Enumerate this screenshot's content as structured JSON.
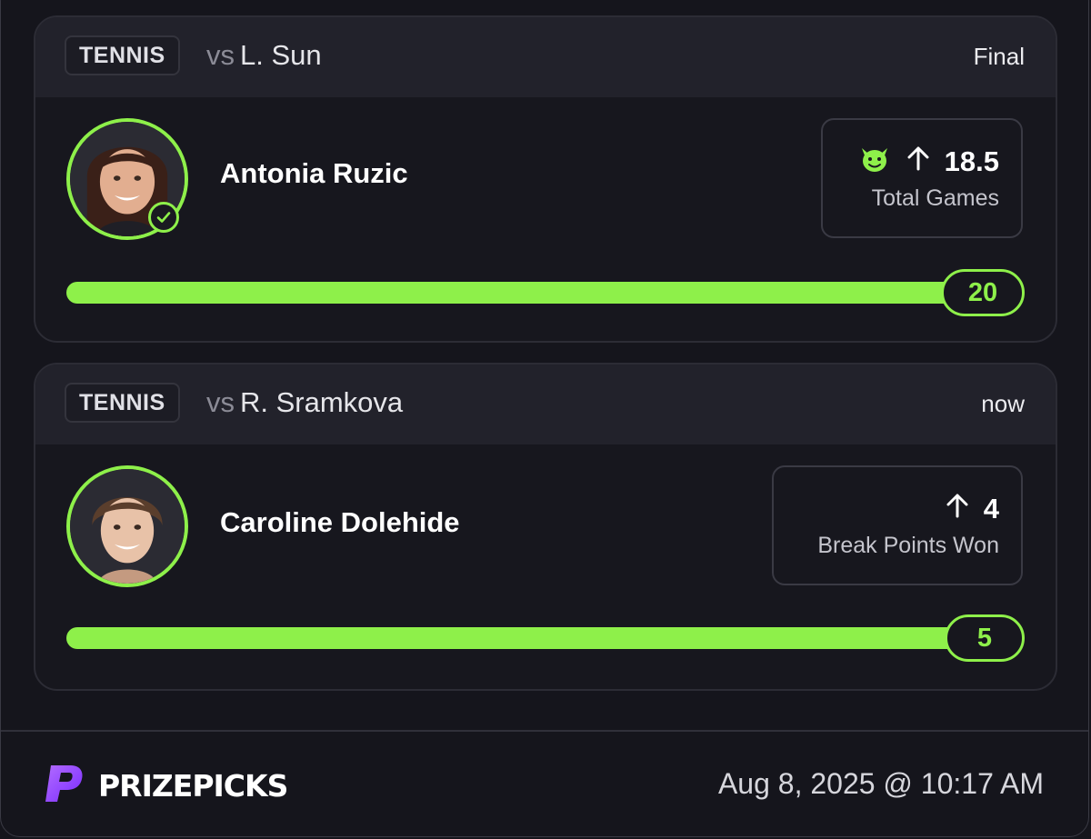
{
  "picks": [
    {
      "sport": "TENNIS",
      "vs_label": "vs",
      "opponent": "L. Sun",
      "status": "Final",
      "player_name": "Antonia Ruzic",
      "stat_value": "18.5",
      "stat_label": "Total Games",
      "direction_icon": "arrow-up-icon",
      "has_goblin_icon": true,
      "result": "20",
      "progress": 1.0,
      "completed": true
    },
    {
      "sport": "TENNIS",
      "vs_label": "vs",
      "opponent": "R. Sramkova",
      "status": "now",
      "player_name": "Caroline Dolehide",
      "stat_value": "4",
      "stat_label": "Break Points Won",
      "direction_icon": "arrow-up-icon",
      "has_goblin_icon": false,
      "result": "5",
      "progress": 1.0,
      "completed": false
    }
  ],
  "footer": {
    "brand": "PRIZEPICKS",
    "timestamp": "Aug 8, 2025 @ 10:17 AM"
  },
  "colors": {
    "accent": "#8ef04a",
    "brand_purple": "#8b3dff",
    "background": "#15151c"
  }
}
